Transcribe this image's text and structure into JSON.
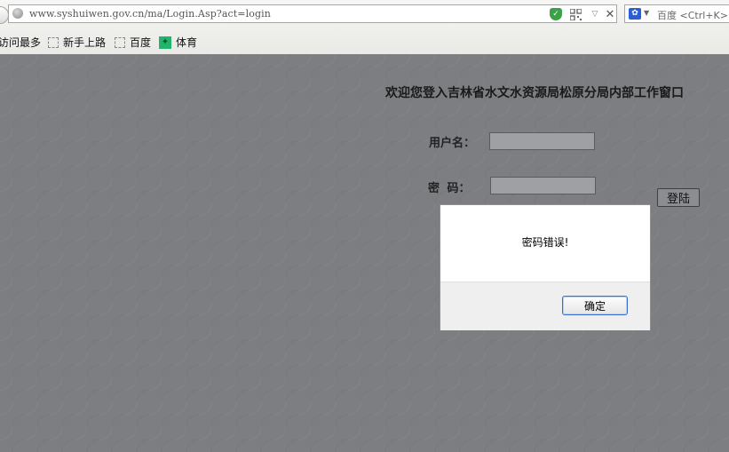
{
  "browser": {
    "url": "www.syshuiwen.gov.cn/ma/Login.Asp?act=login",
    "search_placeholder": "百度 <Ctrl+K>",
    "icons": [
      "back-icon",
      "globe-icon",
      "shield-icon",
      "qr-code-icon",
      "dropdown-icon",
      "stop-icon",
      "baidu-icon"
    ],
    "bookmarks": [
      {
        "label": "访问最多",
        "icon": "none"
      },
      {
        "label": "新手上路",
        "icon": "bookmark-icon"
      },
      {
        "label": "百度",
        "icon": "bookmark-icon"
      },
      {
        "label": "体育",
        "icon": "sports-icon"
      }
    ]
  },
  "page": {
    "welcome": "欢迎您登入吉林省水文水资源局松原分局内部工作窗口",
    "username_label": "用户名：",
    "password_label": "密 码：",
    "username_value": "",
    "password_value": "",
    "login_label": "登陆"
  },
  "alert": {
    "message": "密码错误!",
    "ok_label": "确定"
  }
}
